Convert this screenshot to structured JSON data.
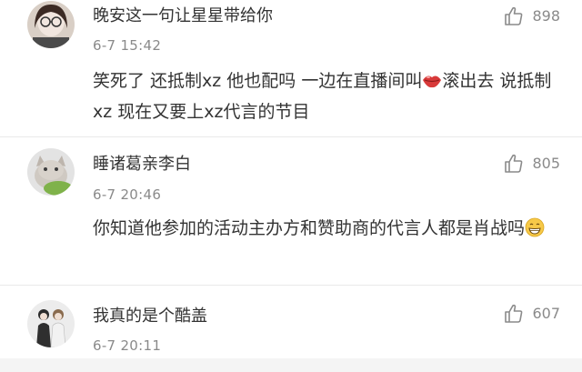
{
  "comments": [
    {
      "username": "晚安这一句让星星带给你",
      "time": "6-7 15:42",
      "likes": "898",
      "text_a": "笑死了 还抵制xz 他也配吗 一边在直播间叫",
      "emoji_a": "lips-emoji",
      "text_b": "滚出去 说抵制xz 现在又要上xz代言的节目"
    },
    {
      "username": "睡诸葛亲李白",
      "time": "6-7 20:46",
      "likes": "805",
      "text_a": "你知道他参加的活动主办方和赞助商的代言人都是肖战吗",
      "emoji_a": "grin-emoji"
    },
    {
      "username": "我真的是个酷盖",
      "time": "6-7 20:11",
      "likes": "607"
    }
  ],
  "icons": {
    "like": "thumbs-up-icon"
  },
  "colors": {
    "text": "#333333",
    "meta": "#8a8a8a",
    "divider": "#e9e9e9"
  }
}
